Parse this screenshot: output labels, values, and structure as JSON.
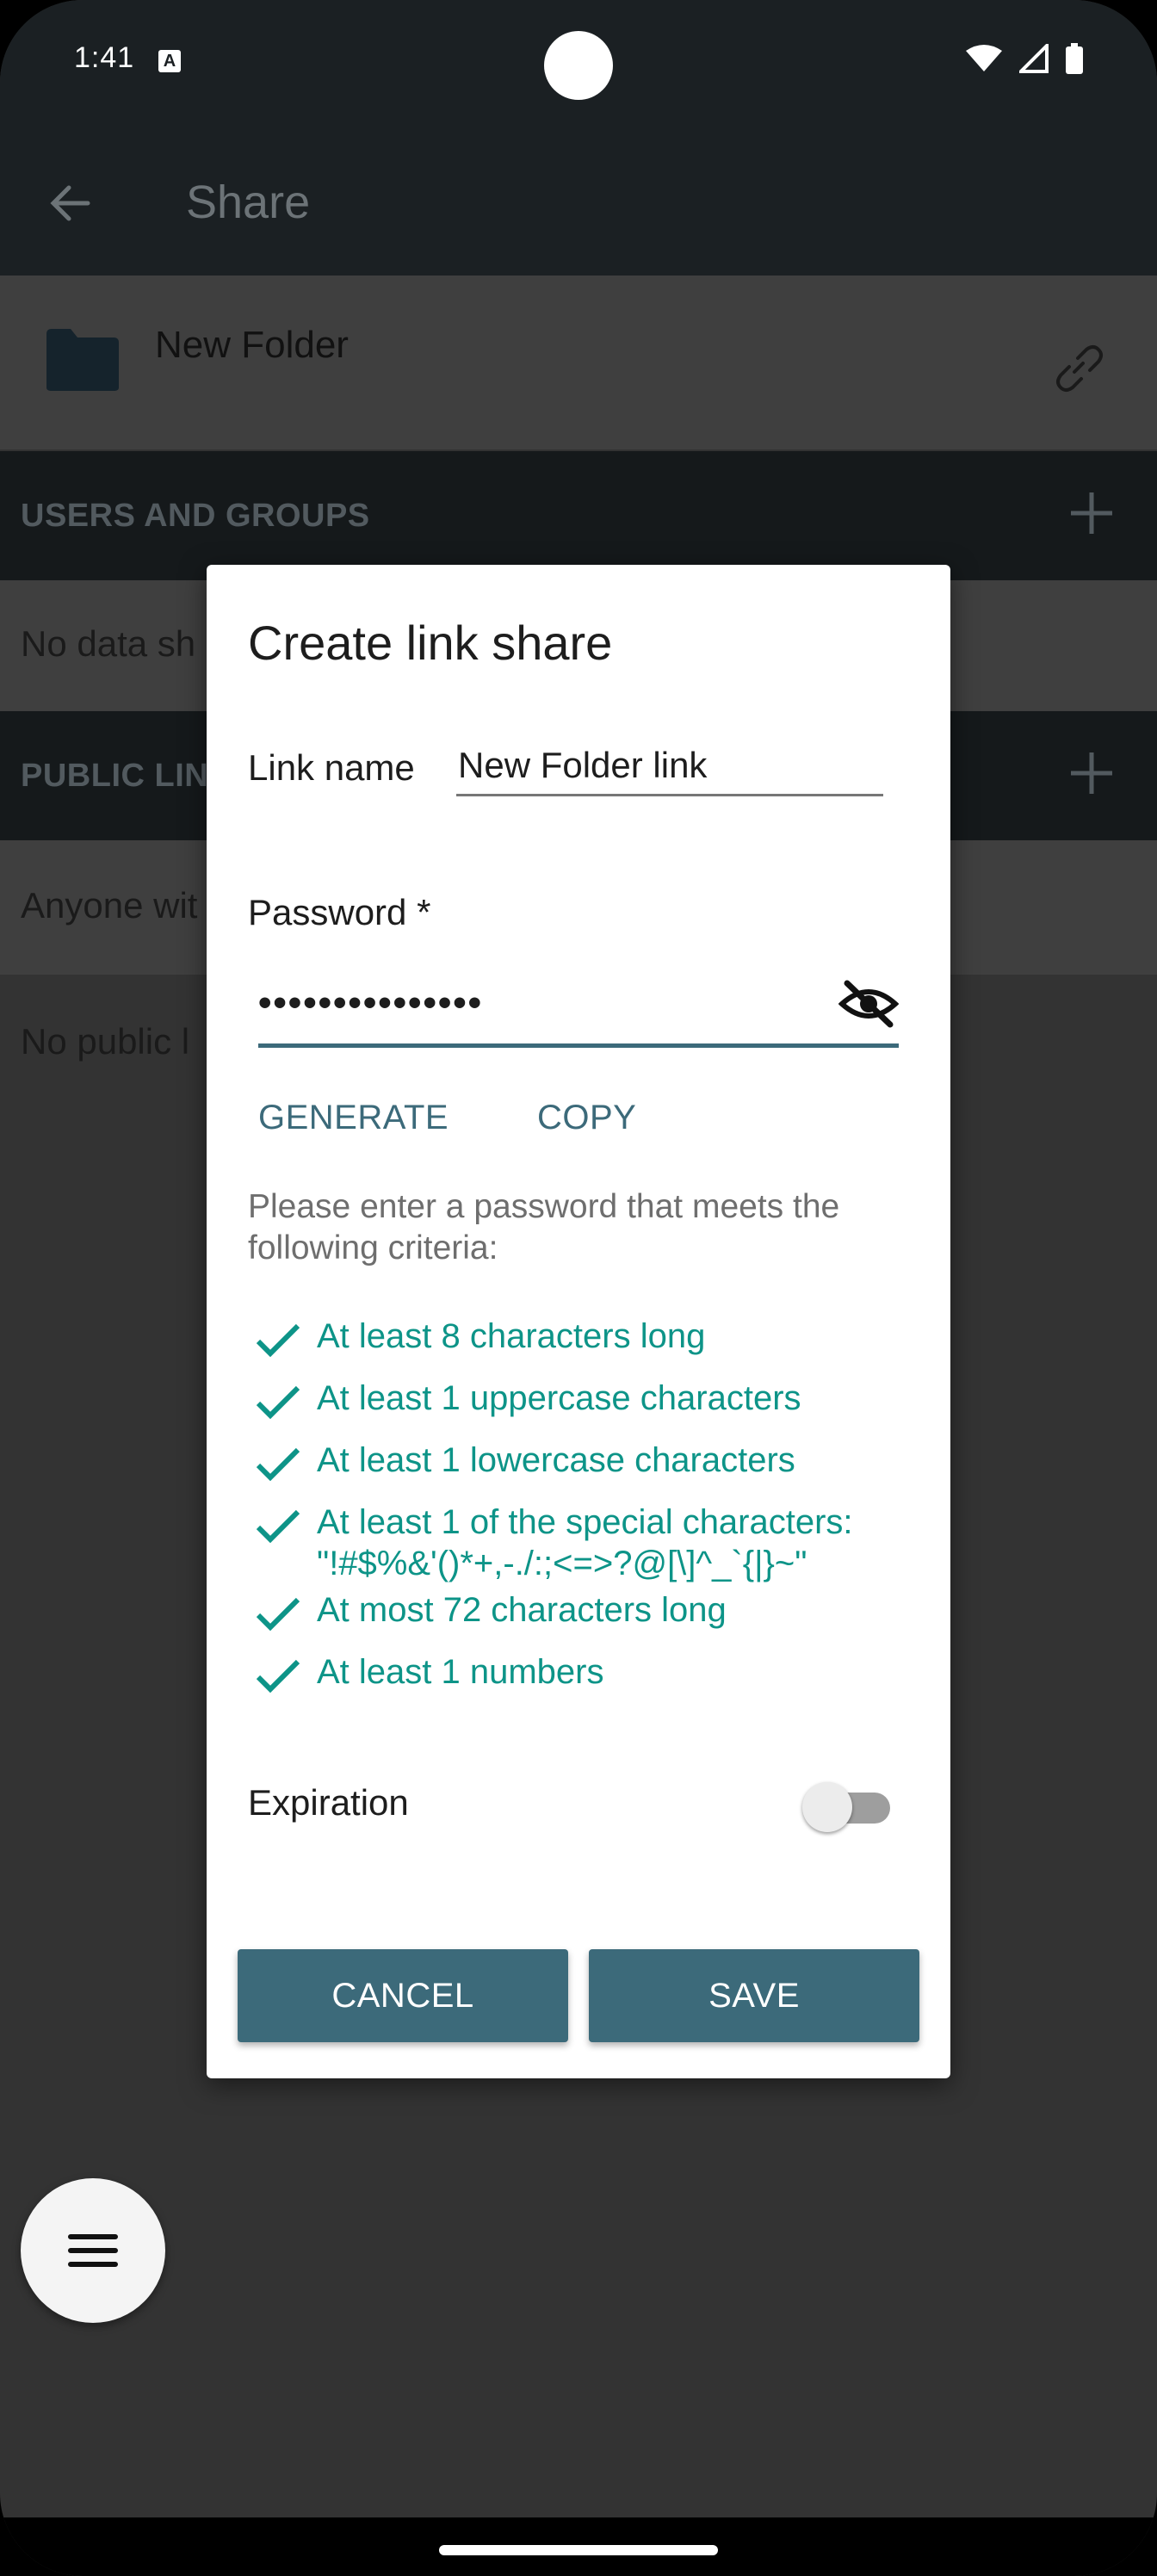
{
  "status_bar": {
    "time": "1:41",
    "notification_badge": "A"
  },
  "app_bar": {
    "title": "Share",
    "back_icon": "arrow-back-icon"
  },
  "folder": {
    "name": "New Folder",
    "icon": "folder-icon",
    "link_icon": "link-icon"
  },
  "sections": {
    "users_groups": {
      "label": "USERS AND GROUPS",
      "empty_text": "No data sh"
    },
    "public_links": {
      "label": "PUBLIC LIN",
      "anyone_text": "Anyone wit",
      "empty_text": "No public l"
    }
  },
  "dialog": {
    "title": "Create link share",
    "link_name_label": "Link name",
    "link_name_value": "New Folder link",
    "password_label": "Password *",
    "password_masked": "•••••••••••••••",
    "generate_label": "GENERATE",
    "copy_label": "COPY",
    "hint": "Please enter a password that meets the following criteria:",
    "criteria": [
      "At least 8 characters long",
      "At least 1 uppercase characters",
      "At least 1 lowercase characters",
      "At least 1 of the special characters:",
      "\"!#$%&'()*+,-./:;<=>?@[\\]^_`{|}~\"",
      "At most 72 characters long",
      "At least 1 numbers"
    ],
    "expiration_label": "Expiration",
    "expiration_enabled": false,
    "cancel_label": "CANCEL",
    "save_label": "SAVE"
  },
  "colors": {
    "accent": "#3c6a7a",
    "criteria_ok": "#0d9488",
    "app_bar": "#1b2023"
  }
}
